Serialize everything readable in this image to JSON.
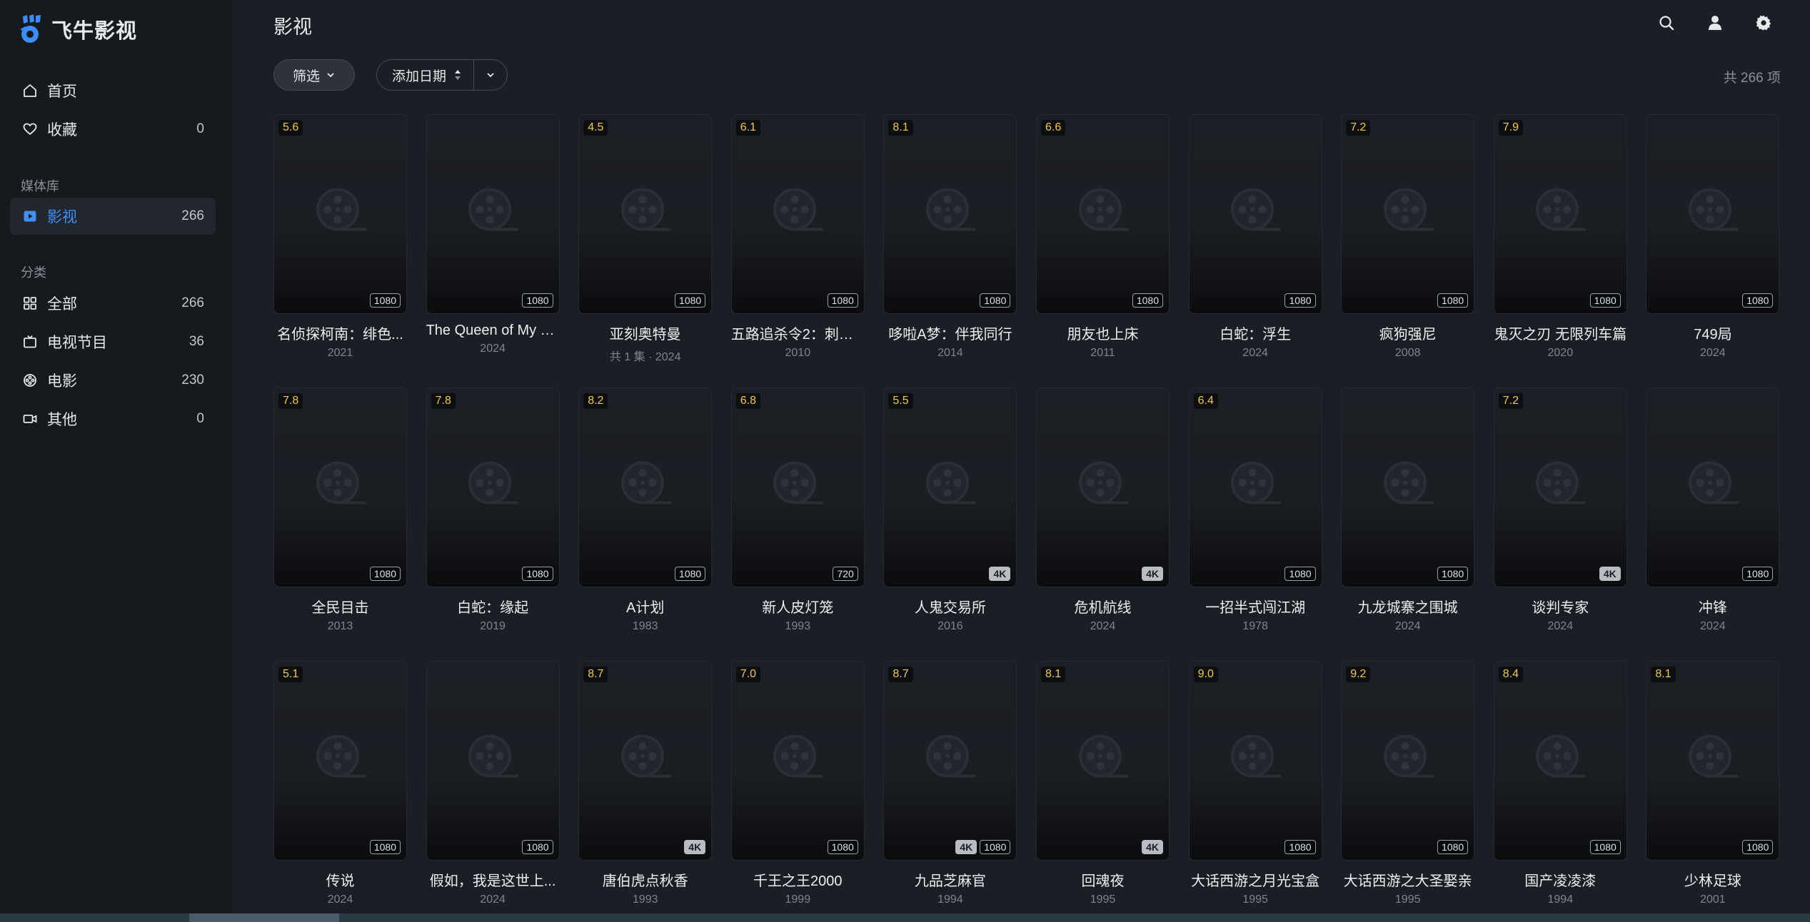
{
  "app": {
    "name": "飞牛影视"
  },
  "sidebar": {
    "home": {
      "label": "首页"
    },
    "favorites": {
      "label": "收藏",
      "count": "0"
    },
    "library_section": "媒体库",
    "library_movies": {
      "label": "影视",
      "count": "266"
    },
    "category_section": "分类",
    "categories": [
      {
        "label": "全部",
        "count": "266"
      },
      {
        "label": "电视节目",
        "count": "36"
      },
      {
        "label": "电影",
        "count": "230"
      },
      {
        "label": "其他",
        "count": "0"
      }
    ]
  },
  "header": {
    "title": "影视",
    "filter_label": "筛选",
    "sort_label": "添加日期",
    "total": "共 266 项"
  },
  "colors": {
    "accent": "#3f8ff5",
    "rating": "#f2c94c",
    "background": "#1b1e24",
    "sidebar": "#16191e"
  },
  "items": [
    {
      "title": "名侦探柯南：绯色...",
      "sub": "2021",
      "rating": "5.6",
      "quality": [
        "1080"
      ]
    },
    {
      "title": "The Queen of My D...",
      "sub": "2024",
      "rating": "",
      "quality": [
        "1080"
      ]
    },
    {
      "title": "亚刻奥特曼",
      "sub": "共 1 集 · 2024",
      "rating": "4.5",
      "quality": [
        "1080"
      ]
    },
    {
      "title": "五路追杀令2：刺客...",
      "sub": "2010",
      "rating": "6.1",
      "quality": [
        "1080"
      ]
    },
    {
      "title": "哆啦A梦：伴我同行",
      "sub": "2014",
      "rating": "8.1",
      "quality": [
        "1080"
      ]
    },
    {
      "title": "朋友也上床",
      "sub": "2011",
      "rating": "6.6",
      "quality": [
        "1080"
      ]
    },
    {
      "title": "白蛇：浮生",
      "sub": "2024",
      "rating": "",
      "quality": [
        "1080"
      ]
    },
    {
      "title": "疯狗强尼",
      "sub": "2008",
      "rating": "7.2",
      "quality": [
        "1080"
      ]
    },
    {
      "title": "鬼灭之刃 无限列车篇",
      "sub": "2020",
      "rating": "7.9",
      "quality": [
        "1080"
      ]
    },
    {
      "title": "749局",
      "sub": "2024",
      "rating": "",
      "quality": [
        "1080"
      ]
    },
    {
      "title": "全民目击",
      "sub": "2013",
      "rating": "7.8",
      "quality": [
        "1080"
      ]
    },
    {
      "title": "白蛇：缘起",
      "sub": "2019",
      "rating": "7.8",
      "quality": [
        "1080"
      ]
    },
    {
      "title": "A计划",
      "sub": "1983",
      "rating": "8.2",
      "quality": [
        "1080"
      ]
    },
    {
      "title": "新人皮灯笼",
      "sub": "1993",
      "rating": "6.8",
      "quality": [
        "720"
      ]
    },
    {
      "title": "人鬼交易所",
      "sub": "2016",
      "rating": "5.5",
      "quality": [
        "4K"
      ]
    },
    {
      "title": "危机航线",
      "sub": "2024",
      "rating": "",
      "quality": [
        "4K"
      ]
    },
    {
      "title": "一招半式闯江湖",
      "sub": "1978",
      "rating": "6.4",
      "quality": [
        "1080"
      ]
    },
    {
      "title": "九龙城寨之围城",
      "sub": "2024",
      "rating": "",
      "quality": [
        "1080"
      ]
    },
    {
      "title": "谈判专家",
      "sub": "2024",
      "rating": "7.2",
      "quality": [
        "4K"
      ]
    },
    {
      "title": "冲锋",
      "sub": "2024",
      "rating": "",
      "quality": [
        "1080"
      ]
    },
    {
      "title": "传说",
      "sub": "2024",
      "rating": "5.1",
      "quality": [
        "1080"
      ]
    },
    {
      "title": "假如，我是这世上...",
      "sub": "2024",
      "rating": "",
      "quality": [
        "1080"
      ]
    },
    {
      "title": "唐伯虎点秋香",
      "sub": "1993",
      "rating": "8.7",
      "quality": [
        "4K"
      ]
    },
    {
      "title": "千王之王2000",
      "sub": "1999",
      "rating": "7.0",
      "quality": [
        "1080"
      ]
    },
    {
      "title": "九品芝麻官",
      "sub": "1994",
      "rating": "8.7",
      "quality": [
        "4K",
        "1080"
      ]
    },
    {
      "title": "回魂夜",
      "sub": "1995",
      "rating": "8.1",
      "quality": [
        "4K"
      ]
    },
    {
      "title": "大话西游之月光宝盒",
      "sub": "1995",
      "rating": "9.0",
      "quality": [
        "1080"
      ]
    },
    {
      "title": "大话西游之大圣娶亲",
      "sub": "1995",
      "rating": "9.2",
      "quality": [
        "1080"
      ]
    },
    {
      "title": "国产凌凌漆",
      "sub": "1994",
      "rating": "8.4",
      "quality": [
        "1080"
      ]
    },
    {
      "title": "少林足球",
      "sub": "2001",
      "rating": "8.1",
      "quality": [
        "1080"
      ]
    }
  ]
}
